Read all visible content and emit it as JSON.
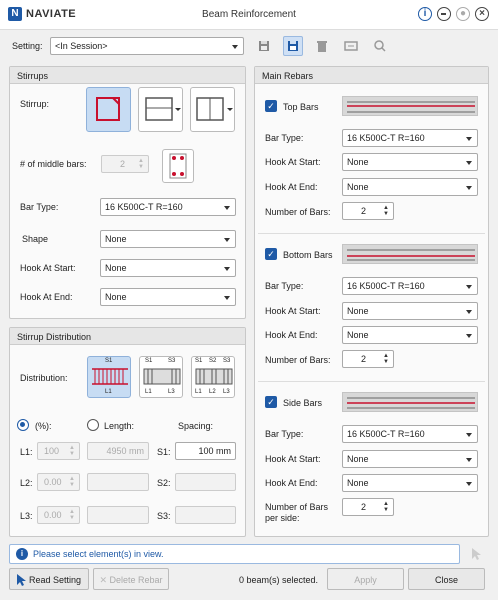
{
  "window": {
    "brand": "NAVIATE",
    "title": "Beam Reinforcement"
  },
  "setting": {
    "label": "Setting:",
    "value": "<In Session>"
  },
  "stirrups": {
    "title": "Stirrups",
    "stirrup_label": "Stirrup:",
    "middle_bars_label": "# of middle bars:",
    "middle_bars_value": "2",
    "bar_type_label": "Bar Type:",
    "bar_type_value": "16 K500C-T R=160",
    "shape_label": "Shape",
    "shape_value": "None",
    "hook_start_label": "Hook At Start:",
    "hook_start_value": "None",
    "hook_end_label": "Hook At End:",
    "hook_end_value": "None"
  },
  "distribution": {
    "title": "Stirrup Distribution",
    "label": "Distribution:",
    "option1": {
      "top": [
        "S1"
      ],
      "bottom": [
        "L1"
      ]
    },
    "option2": {
      "top": [
        "S1",
        "S3"
      ],
      "bottom": [
        "L1",
        "L3"
      ]
    },
    "option3": {
      "top": [
        "S1",
        "S2",
        "S3"
      ],
      "bottom": [
        "L1",
        "L2",
        "L3"
      ]
    },
    "percent_label": "(%):",
    "length_label": "Length:",
    "spacing_label": "Spacing:",
    "l1_label": "L1:",
    "l1_value": "100",
    "l1_length": "4950 mm",
    "s1_label": "S1:",
    "s1_value": "100 mm",
    "l2_label": "L2:",
    "l2_value": "0.00",
    "s2_label": "S2:",
    "l3_label": "L3:",
    "l3_value": "0.00",
    "s3_label": "S3:"
  },
  "main_rebars": {
    "title": "Main Rebars",
    "bar_type_label": "Bar Type:",
    "hook_start_label": "Hook At Start:",
    "hook_end_label": "Hook At End:",
    "num_bars_label": "Number of Bars:",
    "num_bars_side_label_1": "Number of Bars",
    "num_bars_side_label_2": "per side:",
    "top": {
      "label": "Top Bars",
      "bar_type": "16 K500C-T R=160",
      "hook_start": "None",
      "hook_end": "None",
      "count": "2"
    },
    "bottom": {
      "label": "Bottom Bars",
      "bar_type": "16 K500C-T R=160",
      "hook_start": "None",
      "hook_end": "None",
      "count": "2"
    },
    "side": {
      "label": "Side Bars",
      "bar_type": "16 K500C-T R=160",
      "hook_start": "None",
      "hook_end": "None",
      "count": "2"
    }
  },
  "status": {
    "message": "Please select element(s) in view.",
    "selected": "0 beam(s) selected."
  },
  "buttons": {
    "read_setting": "Read Setting",
    "delete_rebar": "Delete Rebar",
    "apply": "Apply",
    "close": "Close"
  },
  "colors": {
    "accent": "#1f5aa6",
    "rebar_red": "#c8102e",
    "selected_bg": "#c7dcf3"
  }
}
